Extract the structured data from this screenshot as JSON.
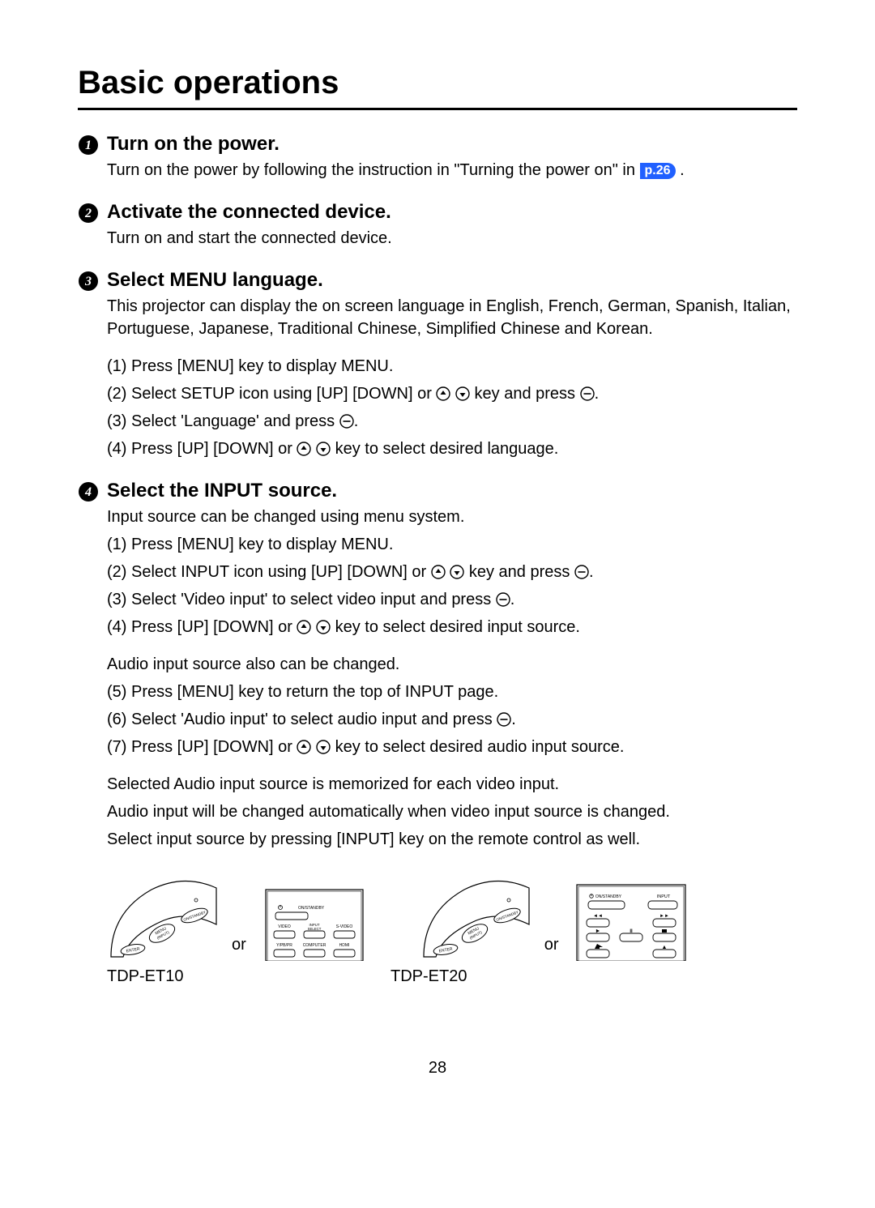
{
  "title": "Basic operations",
  "page_ref": "p.26",
  "page_number": "28",
  "or_label": "or",
  "models": {
    "a": "TDP-ET10",
    "b": "TDP-ET20"
  },
  "steps": [
    {
      "num": "1",
      "heading": "Turn on the power.",
      "body": [
        {
          "type": "p_with_ref",
          "before": "Turn on the power by following the instruction in \"Turning the power on\" in ",
          "after": " ."
        }
      ]
    },
    {
      "num": "2",
      "heading": "Activate the connected device.",
      "body": [
        {
          "type": "p",
          "text": "Turn on and start the connected device."
        }
      ]
    },
    {
      "num": "3",
      "heading": "Select MENU language.",
      "body": [
        {
          "type": "p",
          "text": "This projector can display the on screen language in English, French, German, Spanish, Italian, Portuguese, Japanese, Traditional Chinese, Simplified Chinese and Korean."
        },
        {
          "type": "p",
          "mt": true,
          "text": "(1) Press [MENU] key to display MENU."
        },
        {
          "type": "p_keys_enter",
          "before": "(2) Select SETUP icon using [UP] [DOWN] or ",
          "mid": " key and press ",
          "after": "."
        },
        {
          "type": "p_enter",
          "before": "(3) Select 'Language' and press ",
          "after": "."
        },
        {
          "type": "p_keys",
          "before": "(4) Press [UP] [DOWN] or ",
          "after": " key to select desired language."
        }
      ]
    },
    {
      "num": "4",
      "heading": "Select the INPUT source.",
      "body": [
        {
          "type": "p",
          "text": "Input source can be changed using menu system."
        },
        {
          "type": "p",
          "text": "(1) Press [MENU] key to display MENU."
        },
        {
          "type": "p_keys_enter",
          "before": "(2) Select INPUT icon using [UP] [DOWN] or ",
          "mid": " key and press ",
          "after": "."
        },
        {
          "type": "p_enter",
          "before": "(3) Select 'Video input' to select video input and press ",
          "after": "."
        },
        {
          "type": "p_keys",
          "before": "(4) Press [UP] [DOWN] or ",
          "after": " key to select desired input source."
        },
        {
          "type": "p",
          "mt": true,
          "text": "Audio input source also can be changed."
        },
        {
          "type": "p",
          "text": "(5) Press [MENU] key to return the top of INPUT page."
        },
        {
          "type": "p_enter",
          "before": "(6) Select 'Audio input' to select audio input and press ",
          "after": "."
        },
        {
          "type": "p_keys",
          "before": "(7) Press [UP] [DOWN] or ",
          "after": " key to select desired audio input source."
        },
        {
          "type": "p",
          "mt": true,
          "text": "Selected Audio input source is memorized for each video input."
        },
        {
          "type": "p",
          "text": "Audio input will be changed automatically when video input source is changed."
        },
        {
          "type": "p",
          "text": "Select input source by pressing [INPUT] key on the remote control as well."
        }
      ]
    }
  ],
  "diagrams": {
    "panel_a_labels": {
      "onstandby": "ON/STANDBY",
      "enter": "ENTER",
      "menu": "MENU",
      "input": "(INPUT)"
    },
    "remote_a_labels": {
      "onstandby": "ON/STANDBY",
      "video": "VIDEO",
      "inputselect": "INPUT\nSELECT",
      "svideo": "S-VIDEO",
      "ypbpr": "Y/PB/PR",
      "computer": "COMPUTER",
      "hdmi": "HDMI"
    },
    "remote_b_labels": {
      "onstandby": "ON/STANDBY",
      "input": "INPUT"
    }
  }
}
